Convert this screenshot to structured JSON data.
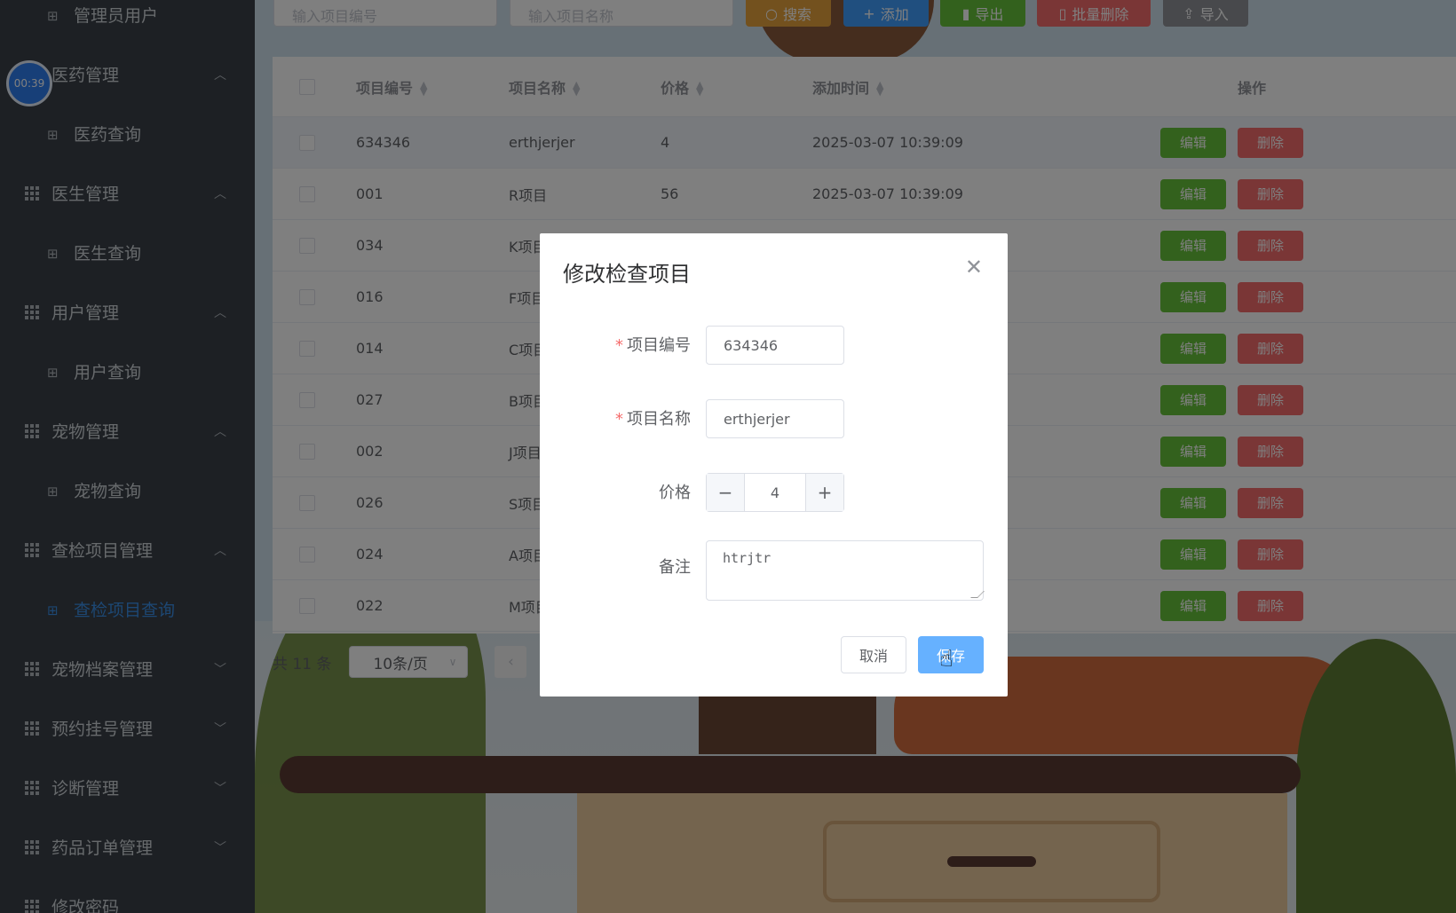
{
  "timer": "00:39",
  "sidebar": {
    "items": [
      {
        "label": "管理员用户",
        "kind": "sub"
      },
      {
        "label": "医药管理",
        "kind": "top",
        "chevron": "up"
      },
      {
        "label": "医药查询",
        "kind": "sub"
      },
      {
        "label": "医生管理",
        "kind": "top",
        "chevron": "up"
      },
      {
        "label": "医生查询",
        "kind": "sub"
      },
      {
        "label": "用户管理",
        "kind": "top",
        "chevron": "up"
      },
      {
        "label": "用户查询",
        "kind": "sub"
      },
      {
        "label": "宠物管理",
        "kind": "top",
        "chevron": "up"
      },
      {
        "label": "宠物查询",
        "kind": "sub"
      },
      {
        "label": "查检项目管理",
        "kind": "top",
        "chevron": "up"
      },
      {
        "label": "查检项目查询",
        "kind": "sub",
        "active": true
      },
      {
        "label": "宠物档案管理",
        "kind": "top",
        "chevron": "down"
      },
      {
        "label": "预约挂号管理",
        "kind": "top",
        "chevron": "down"
      },
      {
        "label": "诊断管理",
        "kind": "top",
        "chevron": "down"
      },
      {
        "label": "药品订单管理",
        "kind": "top",
        "chevron": "down"
      },
      {
        "label": "修改密码",
        "kind": "top"
      }
    ]
  },
  "toolbar": {
    "code_placeholder": "输入项目编号",
    "name_placeholder": "输入项目名称",
    "search_label": "搜索",
    "add_label": "添加",
    "export_label": "导出",
    "batch_delete_label": "批量删除",
    "import_label": "导入"
  },
  "table": {
    "headers": {
      "code": "项目编号",
      "name": "项目名称",
      "price": "价格",
      "time": "添加时间",
      "ops": "操作"
    },
    "edit_label": "编辑",
    "delete_label": "删除",
    "rows": [
      {
        "code": "634346",
        "name": "erthjerjer",
        "price": "4",
        "time": "2025-03-07 10:39:09"
      },
      {
        "code": "001",
        "name": "R项目",
        "price": "56",
        "time": "2025-03-07 10:39:09"
      },
      {
        "code": "034",
        "name": "K项目",
        "price": "",
        "time": ""
      },
      {
        "code": "016",
        "name": "F项目",
        "price": "",
        "time": ""
      },
      {
        "code": "014",
        "name": "C项目",
        "price": "",
        "time": ""
      },
      {
        "code": "027",
        "name": "B项目",
        "price": "",
        "time": ""
      },
      {
        "code": "002",
        "name": "J项目",
        "price": "",
        "time": ""
      },
      {
        "code": "026",
        "name": "S项目",
        "price": "",
        "time": ""
      },
      {
        "code": "024",
        "name": "A项目",
        "price": "",
        "time": ""
      },
      {
        "code": "022",
        "name": "M项目",
        "price": "",
        "time": ""
      }
    ]
  },
  "pager": {
    "total": "共 11 条",
    "page_size": "10条/页"
  },
  "dialog": {
    "title": "修改检查项目",
    "code_label": "项目编号",
    "code_value": "634346",
    "name_label": "项目名称",
    "name_value": "erthjerjer",
    "price_label": "价格",
    "price_value": "4",
    "note_label": "备注",
    "note_value": "htrjtr",
    "cancel_label": "取消",
    "save_label": "保存"
  },
  "colors": {
    "sidebar": "#3a4149",
    "active": "#3a8ee6",
    "edit": "#67c23a",
    "delete": "#f56c6c",
    "save": "#66b1ff"
  }
}
